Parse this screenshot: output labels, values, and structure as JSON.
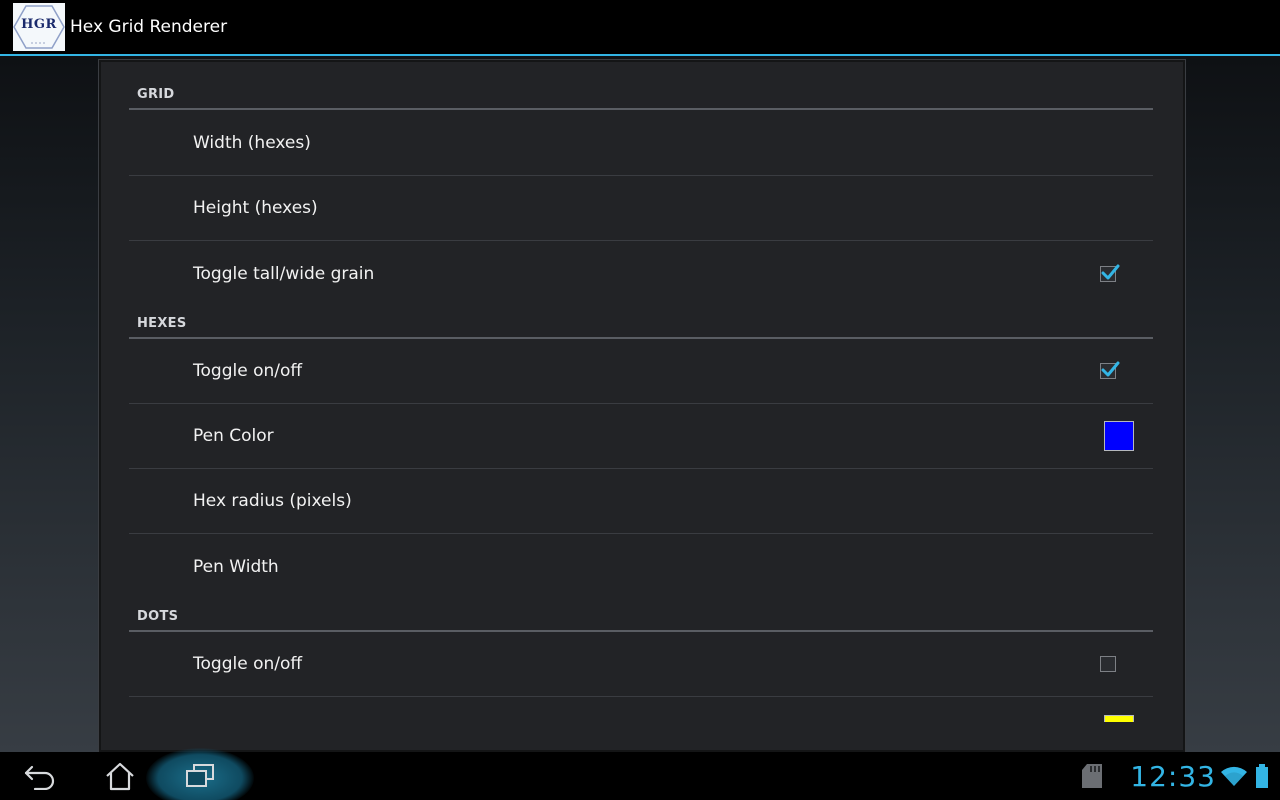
{
  "app": {
    "title": "Hex Grid Renderer",
    "icon_text": "HGR",
    "icon_name": "app-logo-icon"
  },
  "sections": [
    {
      "title": "GRID",
      "items": [
        {
          "label": "Width (hexes)",
          "widget": "none"
        },
        {
          "label": "Height (hexes)",
          "widget": "none"
        },
        {
          "label": "Toggle tall/wide grain",
          "widget": "checkbox",
          "checked": true
        }
      ]
    },
    {
      "title": "HEXES",
      "items": [
        {
          "label": "Toggle on/off",
          "widget": "checkbox",
          "checked": true
        },
        {
          "label": "Pen Color",
          "widget": "color",
          "color": "#0000ff"
        },
        {
          "label": "Hex radius (pixels)",
          "widget": "none"
        },
        {
          "label": "Pen Width",
          "widget": "none"
        }
      ]
    },
    {
      "title": "DOTS",
      "items": [
        {
          "label": "Toggle on/off",
          "widget": "checkbox",
          "checked": false
        },
        {
          "label": "",
          "widget": "color",
          "color": "#ffff00"
        }
      ]
    }
  ],
  "navigation": {
    "back_icon": "back-icon",
    "home_icon": "home-icon",
    "recents_icon": "recent-apps-icon"
  },
  "status": {
    "time": "12:33",
    "sd_icon": "sd-card-icon",
    "wifi_icon": "wifi-icon",
    "battery_icon": "battery-icon"
  },
  "colors": {
    "accent": "#33b5e5",
    "hexes_pen_color": "#0000ff",
    "dots_pen_color": "#ffff00"
  }
}
